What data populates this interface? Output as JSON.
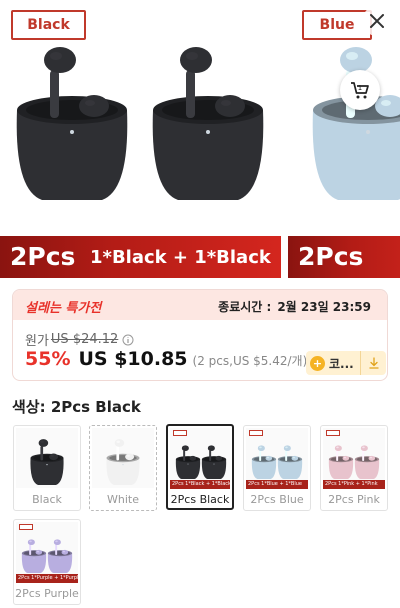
{
  "hero": {
    "slides": [
      {
        "tag": "Black",
        "banner_count": "2Pcs",
        "banner_combo": "1*Black + 1*Black",
        "product_color": "#2e2f33"
      },
      {
        "tag": "Blue",
        "banner_count": "2Pcs",
        "banner_combo": "",
        "product_color": "#bcd3e3"
      }
    ],
    "close_icon": "close-icon",
    "cart_icon": "cart-icon"
  },
  "sale": {
    "title": "설레는 특가전",
    "end_label": "종료시간 :",
    "end_time": "2월 23일 23:59",
    "original_label": "원가",
    "original_price": "US $24.12",
    "discount": "55%",
    "price": "US $10.85",
    "unit_info": "(2 pcs,US $5.42/개)",
    "coupon_label": "코..."
  },
  "color": {
    "title": "색상: 2Pcs Black",
    "options": [
      {
        "name": "Black",
        "color": "#2e2f33",
        "pair": false,
        "state": "normal"
      },
      {
        "name": "White",
        "color": "#f1f1f1",
        "pair": false,
        "state": "unavailable"
      },
      {
        "name": "2Pcs Black",
        "color": "#2e2f33",
        "pair": true,
        "band": "1*Black + 1*Black",
        "state": "selected"
      },
      {
        "name": "2Pcs Blue",
        "color": "#bcd3e3",
        "pair": true,
        "band": "1*Blue + 1*Blue",
        "state": "normal"
      },
      {
        "name": "2Pcs Pink",
        "color": "#e8c3cd",
        "pair": true,
        "band": "1*Pink + 1*Pink",
        "state": "normal"
      },
      {
        "name": "2Pcs Purple",
        "color": "#b8aee0",
        "pair": true,
        "band": "1*Purple + 1*Purple",
        "state": "normal"
      }
    ]
  },
  "colors": {
    "accent": "#e8322a",
    "banner_red": "#b31c16",
    "sale_bg": "#fde7e2",
    "coupon_bg": "#fff1d2"
  }
}
